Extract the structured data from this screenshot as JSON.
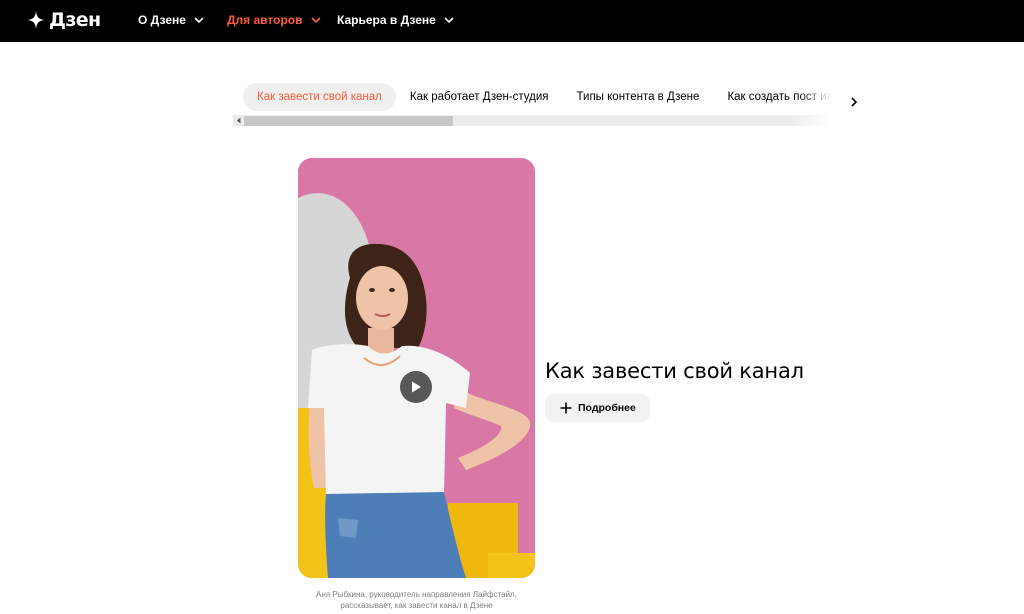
{
  "header": {
    "logo_text": "Дзен",
    "nav": [
      {
        "label": "О Дзене",
        "icon": "chevron-down-icon"
      },
      {
        "label": "Для авторов",
        "icon": "chevron-down-icon",
        "active": true
      },
      {
        "label": "Карьера в Дзене",
        "icon": "chevron-down-icon"
      }
    ]
  },
  "tabs": [
    {
      "label": "Как завести свой канал",
      "active": true
    },
    {
      "label": "Как работает Дзен-студия"
    },
    {
      "label": "Типы контента в Дзене"
    },
    {
      "label": "Как создать пост или статью"
    }
  ],
  "video": {
    "caption": "Аня Рыбкина, руководитель направления Лайфстайл, рассказывает, как завести канал в Дзене",
    "play_icon": "play-icon"
  },
  "content": {
    "title": "Как завести свой канал",
    "more_label": "Подробнее"
  },
  "colors": {
    "accent": "#ff5c38",
    "header_bg": "#000000",
    "video_bg": "#d76fa0",
    "button_bg": "#f2f2f2"
  }
}
